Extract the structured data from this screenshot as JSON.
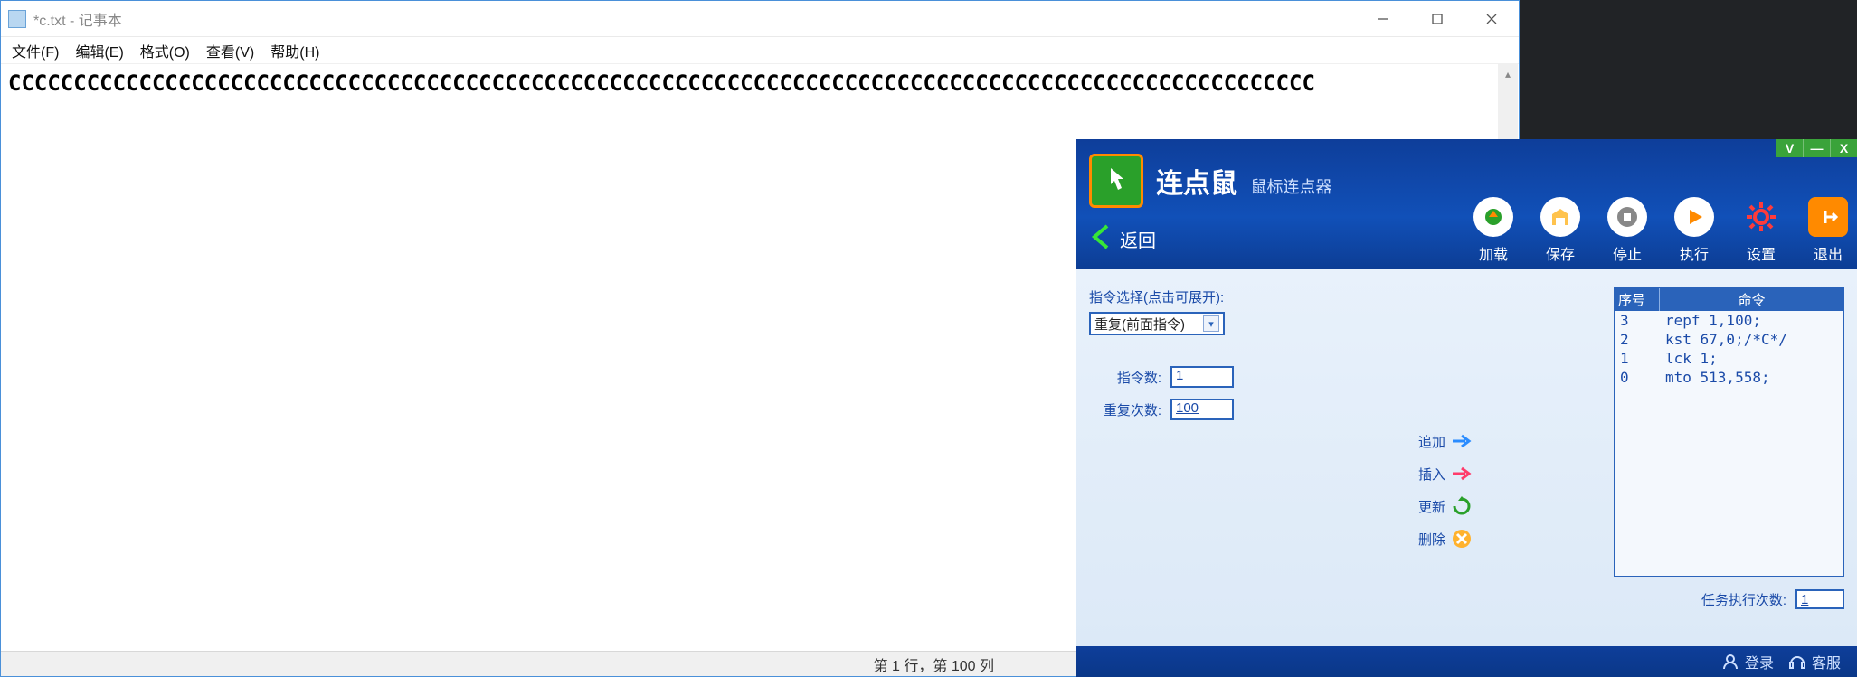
{
  "notepad": {
    "title": "*c.txt - 记事本",
    "menu": [
      "文件(F)",
      "编辑(E)",
      "格式(O)",
      "查看(V)",
      "帮助(H)"
    ],
    "body": "CCCCCCCCCCCCCCCCCCCCCCCCCCCCCCCCCCCCCCCCCCCCCCCCCCCCCCCCCCCCCCCCCCCCCCCCCCCCCCCCCCCCCCCCCCCCCCCCCCCC",
    "status": "第 1 行，第 100 列"
  },
  "clicker": {
    "title": "连点鼠",
    "subtitle": "鼠标连点器",
    "winctl": {
      "v": "V",
      "min": "—",
      "close": "X"
    },
    "back": "返回",
    "toolbar": {
      "load": "加载",
      "save": "保存",
      "stop": "停止",
      "run": "执行",
      "settings": "设置",
      "exit": "退出"
    },
    "left": {
      "selectLabel": "指令选择(点击可展开):",
      "selectValue": "重复(前面指令)",
      "cmdCountLabel": "指令数:",
      "cmdCountValue": "1",
      "repeatLabel": "重复次数:",
      "repeatValue": "100"
    },
    "actions": {
      "append": "追加",
      "insert": "插入",
      "update": "更新",
      "delete": "删除"
    },
    "table": {
      "hSeq": "序号",
      "hCmd": "命令",
      "rows": [
        {
          "seq": "3",
          "cmd": "repf 1,100;"
        },
        {
          "seq": "2",
          "cmd": "kst 67,0;/*C*/"
        },
        {
          "seq": "1",
          "cmd": "lck 1;"
        },
        {
          "seq": "0",
          "cmd": "mto 513,558;"
        }
      ]
    },
    "taskLabel": "任务执行次数:",
    "taskValue": "1",
    "footer": {
      "login": "登录",
      "support": "客服"
    }
  }
}
